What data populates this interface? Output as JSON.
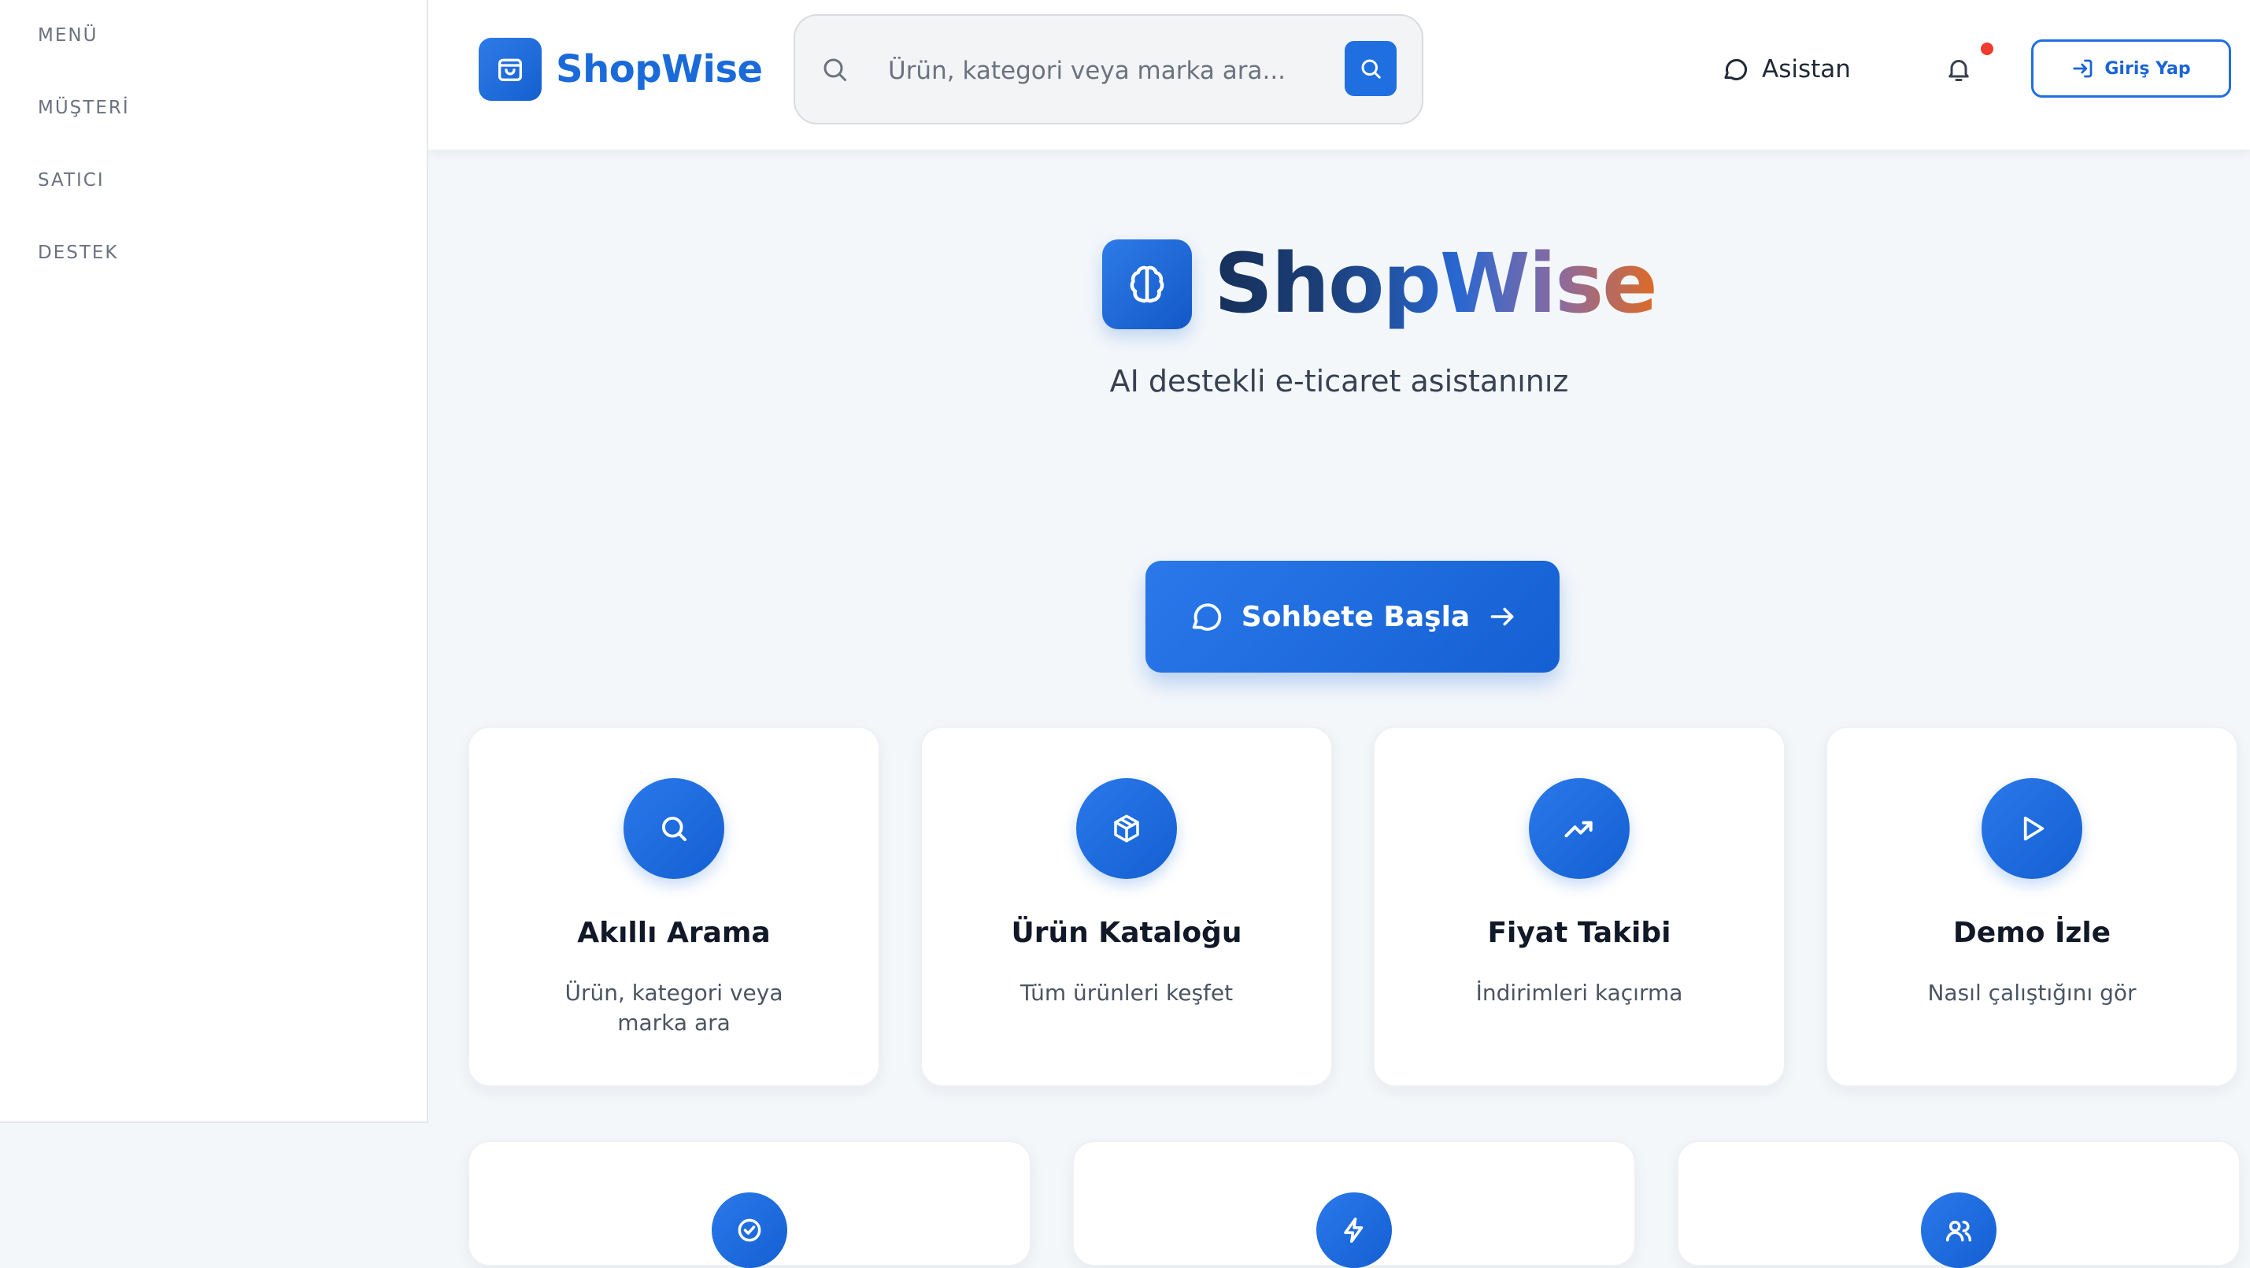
{
  "sidebar": {
    "items": [
      {
        "label": "MENÜ"
      },
      {
        "label": "MÜŞTERİ"
      },
      {
        "label": "SATICI"
      },
      {
        "label": "DESTEK"
      }
    ]
  },
  "header": {
    "brand": "ShopWise",
    "search": {
      "placeholder": "Ürün, kategori veya marka ara..."
    },
    "assistant_label": "Asistan",
    "login_label": "Giriş Yap"
  },
  "hero": {
    "title": "ShopWise",
    "subtitle": "AI destekli e-ticaret asistanınız",
    "cta_label": "Sohbete Başla"
  },
  "features": [
    {
      "title": "Akıllı Arama",
      "desc": "Ürün, kategori veya marka ara",
      "icon": "search-icon"
    },
    {
      "title": "Ürün Kataloğu",
      "desc": "Tüm ürünleri keşfet",
      "icon": "package-icon"
    },
    {
      "title": "Fiyat Takibi",
      "desc": "İndirimleri kaçırma",
      "icon": "trending-up-icon"
    },
    {
      "title": "Demo İzle",
      "desc": "Nasıl çalıştığını gör",
      "icon": "play-icon"
    }
  ],
  "secondary_cards": [
    {
      "icon": "check-circle-icon"
    },
    {
      "icon": "zap-icon"
    },
    {
      "icon": "users-icon"
    }
  ],
  "colors": {
    "primary": "#1f6fe0",
    "background": "#f4f7fa",
    "notification_dot": "#ef3a2f",
    "title_gradient_start": "#16305a",
    "title_gradient_end": "#de6a25"
  }
}
